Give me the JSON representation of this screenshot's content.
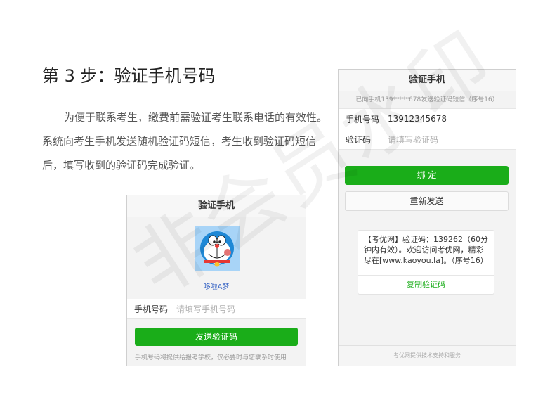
{
  "title": "第 3 步：验证手机号码",
  "description": "为便于联系考生，缴费前需验证考生联系电话的有效性。系统向考生手机发送随机验证码短信，考生收到验证码短信后，填写收到的验证码完成验证。",
  "watermark": "非会员水印",
  "left_panel": {
    "header": "验证手机",
    "nickname": "哆啦A梦",
    "phone_label": "手机号码",
    "phone_placeholder": "请填写手机号码",
    "send_button": "发送验证码",
    "note": "手机号码将提供给报考学校，仅必要时与您联系时使用"
  },
  "right_panel": {
    "header": "验证手机",
    "sent_info": "已向手机139*****678发送验证码短信（序号16）",
    "phone_label": "手机号码",
    "phone_value": "13912345678",
    "code_label": "验证码",
    "code_placeholder": "请填写验证码",
    "bind_button": "绑 定",
    "resend_button": "重新发送",
    "sms_text": "【考优网】验证码：139262（60分钟内有效）。欢迎访问考优网，精彩尽在[www.kaoyou.la]。（序号16）",
    "copy_button": "复制验证码",
    "footer": "考优网提供技术支持和服务"
  },
  "colors": {
    "primary_green": "#1aad19",
    "avatar_bg": "#a8d4f7",
    "nickname_blue": "#3a66c5"
  }
}
